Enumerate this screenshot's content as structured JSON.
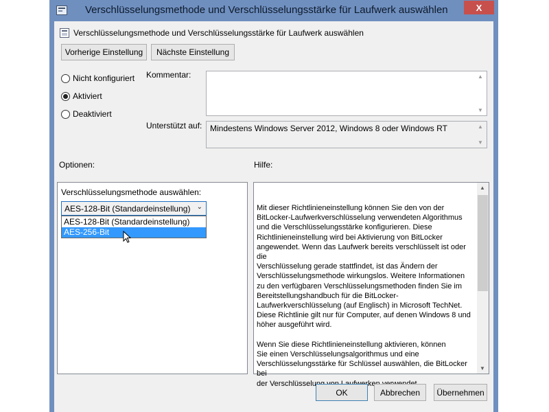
{
  "window": {
    "title": "Verschlüsselungsmethode und Verschlüsselungsstärke für Laufwerk auswählen",
    "close_glyph": "X"
  },
  "header": {
    "text": "Verschlüsselungsmethode und Verschlüsselungsstärke für Laufwerk auswählen"
  },
  "nav": {
    "prev_label": "Vorherige Einstellung",
    "next_label": "Nächste Einstellung"
  },
  "state": {
    "options": [
      {
        "label": "Nicht konfiguriert",
        "checked": false
      },
      {
        "label": "Aktiviert",
        "checked": true
      },
      {
        "label": "Deaktiviert",
        "checked": false
      }
    ]
  },
  "comment": {
    "label": "Kommentar:",
    "value": ""
  },
  "supported": {
    "label": "Unterstützt auf:",
    "value": "Mindestens Windows Server 2012, Windows 8 oder Windows RT"
  },
  "options_section": {
    "label": "Optionen:",
    "method_label": "Verschlüsselungsmethode auswählen:",
    "combo_value": "AES-128-Bit (Standardeinstellung)",
    "dropdown_items": [
      "AES-128-Bit (Standardeinstellung)",
      "AES-256-Bit"
    ],
    "highlighted_index": 1
  },
  "help_section": {
    "label": "Hilfe:",
    "text": "            Mit dieser Richtlinieneinstellung können Sie den von der\nBitLocker-Laufwerkverschlüsselung verwendeten Algorithmus\nund die Verschlüsselungsstärke konfigurieren. Diese\nRichtlinieneinstellung wird bei Aktivierung von BitLocker\nangewendet. Wenn das Laufwerk bereits verschlüsselt ist oder die\nVerschlüsselung gerade stattfindet, ist das Ändern der\nVerschlüsselungsmethode wirkungslos. Weitere Informationen\nzu den verfügbaren Verschlüsselungsmethoden finden Sie im\nBereitstellungshandbuch für die BitLocker-\nLaufwerkverschlüsselung (auf Englisch) in Microsoft TechNet.\nDiese Richtlinie gilt nur für Computer, auf denen Windows 8 und\nhöher ausgeführt wird.\n\n            Wenn Sie diese Richtlinieneinstellung aktivieren, können\nSie einen Verschlüsselungsalgorithmus und eine\nVerschlüsselungsstärke für Schlüssel auswählen, die BitLocker bei\nder Verschlüsselung von Laufwerken verwendet."
  },
  "footer": {
    "ok_label": "OK",
    "cancel_label": "Abbrechen",
    "apply_label": "Übernehmen"
  },
  "colors": {
    "titlebar": "#6f8fbf",
    "client": "#f0f0f0",
    "selection": "#3399ff",
    "close": "#c7504d"
  }
}
